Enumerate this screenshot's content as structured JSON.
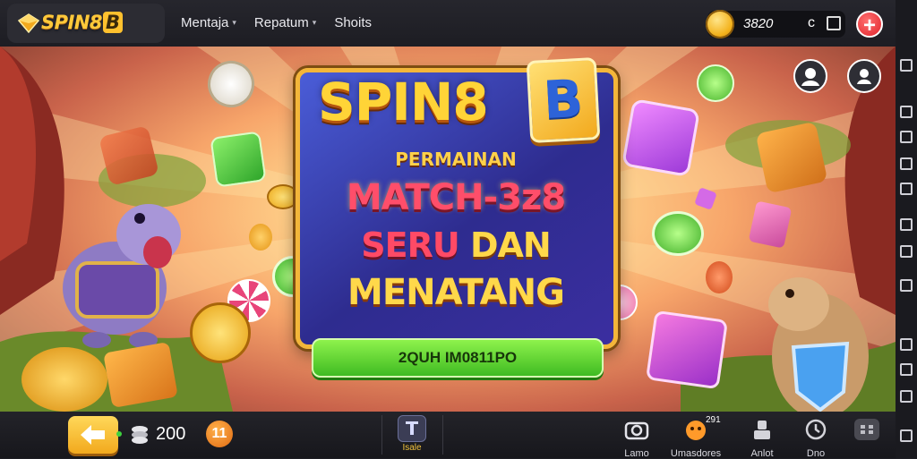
{
  "header": {
    "logo_text": "SPIN8",
    "logo_badge": "B",
    "nav": [
      {
        "label": "Mentaja",
        "has_dropdown": true
      },
      {
        "label": "Repatum",
        "has_dropdown": true
      },
      {
        "label": "Shoits",
        "has_dropdown": false
      }
    ],
    "coins": "3820",
    "coin_suffix": "c",
    "plus_label": "+"
  },
  "banner": {
    "title": "SPIN8",
    "title_badge": "B",
    "subtitle": "PERMAINAN",
    "line1": "MATCH-3z8",
    "line2a": "SERU",
    "line2b": "DAN",
    "line3": "MENATANG",
    "cta_label": "2QUH IM0811PO"
  },
  "footer": {
    "chip_value": "200",
    "pause_label": "11",
    "center_label": "Isale",
    "nav": [
      {
        "label": "Lamo",
        "icon": "camera-icon"
      },
      {
        "label": "Umasdores",
        "icon": "monster-icon",
        "badge": "291"
      },
      {
        "label": "Anlot",
        "icon": "user-icon"
      },
      {
        "label": "Dno",
        "icon": "clock-icon"
      },
      {
        "label": "",
        "icon": "grid-icon"
      }
    ]
  },
  "colors": {
    "accent_gold": "#ffc93a",
    "cta_green": "#3fbb22",
    "danger_red": "#e0242c",
    "banner_blue": "#2e2c8f"
  }
}
